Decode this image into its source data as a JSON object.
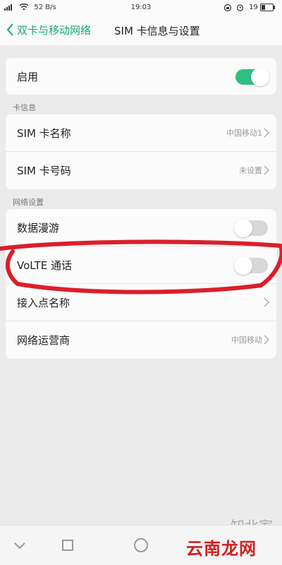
{
  "status_bar": {
    "network_speed": "52 B/s",
    "time": "19:03",
    "battery_level": "19"
  },
  "header": {
    "back_label": "双卡与移动网络",
    "title": "SIM 卡信息与设置"
  },
  "enable_row": {
    "label": "启用",
    "toggle_on": true
  },
  "card_info": {
    "header": "卡信息",
    "rows": [
      {
        "label": "SIM 卡名称",
        "value": "中国移动1"
      },
      {
        "label": "SIM 卡号码",
        "value": "未设置"
      }
    ]
  },
  "network_settings": {
    "header": "网络设置",
    "rows": [
      {
        "label": "数据漫游",
        "toggle_on": false
      },
      {
        "label": "VoLTE 通话",
        "toggle_on": false
      },
      {
        "label": "接入点名称"
      },
      {
        "label": "网络运营商",
        "value": "中国移动"
      }
    ]
  },
  "bottom_nav": {
    "back_icon": "chevron-down-icon",
    "recents_icon": "square-icon",
    "home_icon": "circle-icon"
  },
  "watermarks": {
    "gray": "知北家",
    "red": "云南龙网"
  },
  "colors": {
    "accent": "#18a67a",
    "toggle_on": "#2fbf7f",
    "annotation": "#d91f2b"
  }
}
